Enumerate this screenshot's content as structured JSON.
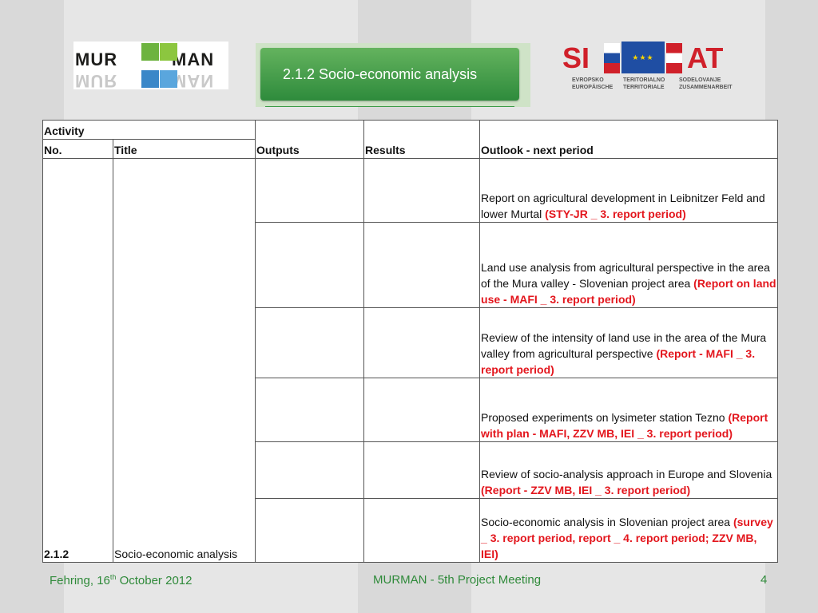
{
  "header": {
    "logo_left_text_1": "MUR",
    "logo_left_text_2": "MAN",
    "title": "2.1.2 Socio-economic analysis",
    "logo_right_text_1": "SI",
    "logo_right_text_2": "AT",
    "logo_right_sub_1": "EVROPSKO EUROPÄISCHE",
    "logo_right_sub_2": "TERITORIALNO TERRITORIALE",
    "logo_right_sub_3": "SODELOVANJE ZUSAMMENARBEIT"
  },
  "table": {
    "header_activity": "Activity",
    "header_no": "No.",
    "header_title": "Title",
    "header_outputs": "Outputs",
    "header_results": "Results",
    "header_outlook": "Outlook - next period",
    "activity_no": "2.1.2",
    "activity_title": "Socio-economic analysis",
    "rows": [
      {
        "text": "Report on agricultural development in Leibnitzer Feld and lower Murtal ",
        "note": "(STY-JR _ 3. report period)"
      },
      {
        "text": "Land use analysis from agricultural perspective in the area of the Mura valley - Slovenian project area ",
        "note": "(Report on land use - MAFI _ 3. report period)"
      },
      {
        "text": "Review of the intensity of land use in the area of the Mura valley from agricultural perspective ",
        "note": "(Report - MAFI _ 3. report period)"
      },
      {
        "text": "Proposed experiments on lysimeter station Tezno ",
        "note": "(Report with plan  - MAFI, ZZV MB, IEI _ 3. report period)"
      },
      {
        "text": "Review of socio-analysis approach in Europe and Slovenia ",
        "note": "(Report - ZZV MB, IEI _ 3. report period)"
      },
      {
        "text": "Socio-economic analysis in Slovenian project area ",
        "note": "(survey _ 3. report period, report _ 4. report period; ZZV MB, IEI)"
      }
    ]
  },
  "footer": {
    "left_prefix": "Fehring, 16",
    "left_sup": "th",
    "left_suffix": " October 2012",
    "center": "MURMAN - 5th Project Meeting",
    "page_number": "4"
  },
  "colors": {
    "accent_green": "#2f8a3a",
    "note_red": "#e3161d"
  }
}
